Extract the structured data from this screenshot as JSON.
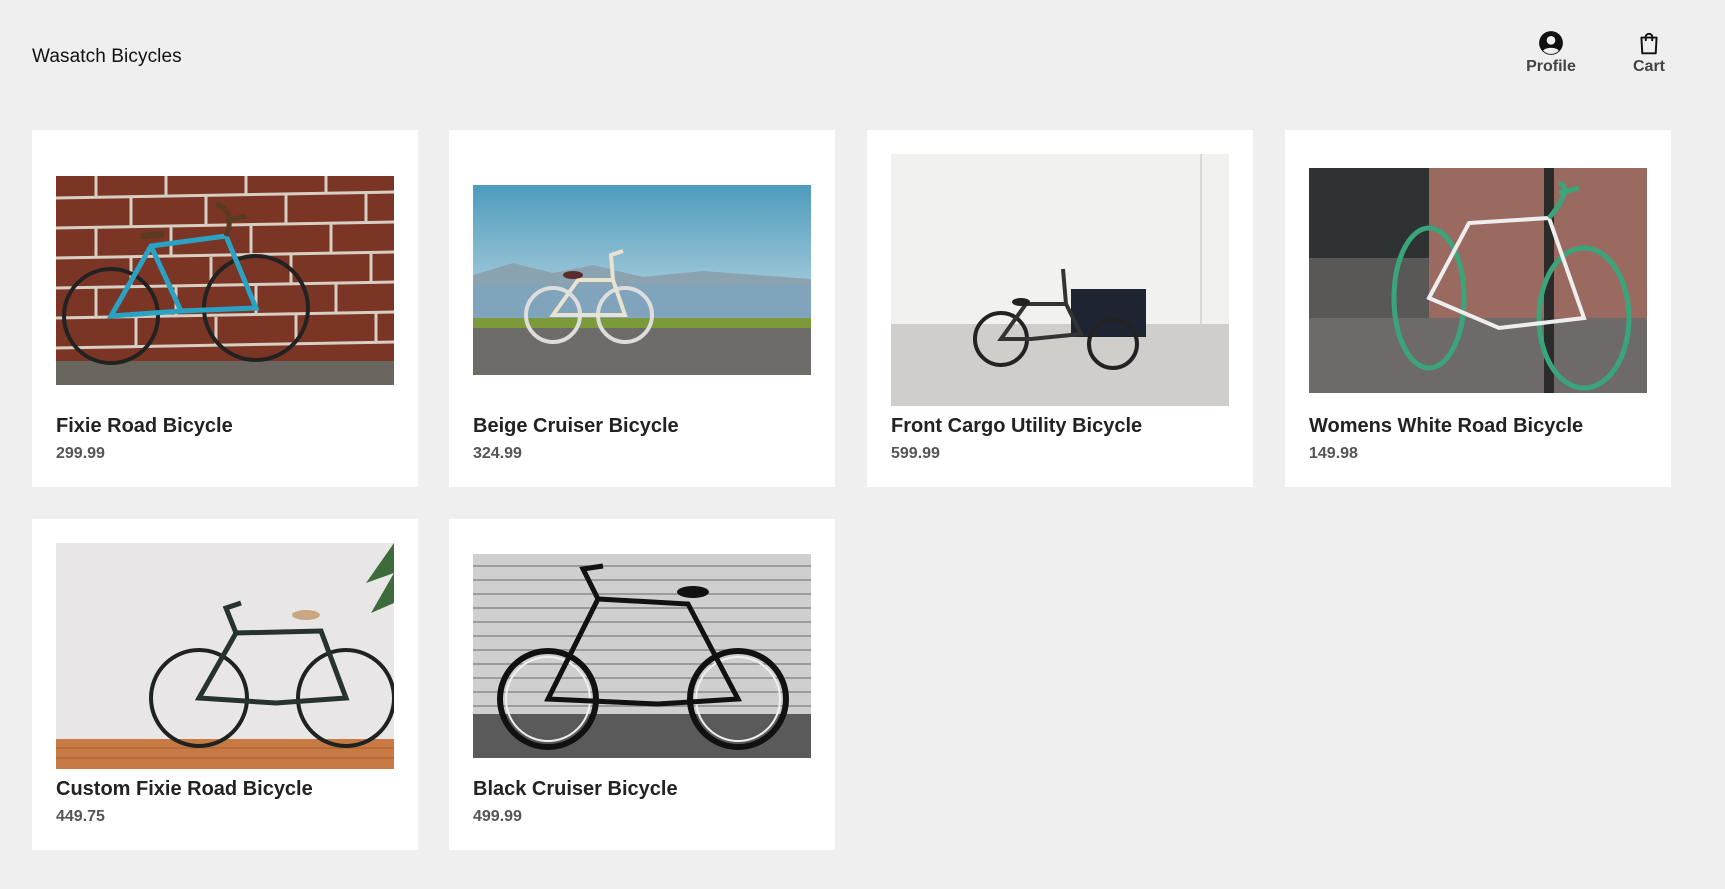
{
  "header": {
    "brand": "Wasatch Bicycles",
    "profile_label": "Profile",
    "cart_label": "Cart",
    "profile_icon": "user-circle-icon",
    "cart_icon": "shopping-bag-icon"
  },
  "products": [
    {
      "name": "Fixie Road Bicycle",
      "price": "299.99"
    },
    {
      "name": "Beige Cruiser Bicycle",
      "price": "324.99"
    },
    {
      "name": "Front Cargo Utility Bicycle",
      "price": "599.99"
    },
    {
      "name": "Womens White Road Bicycle",
      "price": "149.98"
    },
    {
      "name": "Custom Fixie Road Bicycle",
      "price": "449.75"
    },
    {
      "name": "Black Cruiser Bicycle",
      "price": "499.99"
    }
  ],
  "colors": {
    "background": "#efefef",
    "card": "#ffffff",
    "text": "#222222",
    "price": "#555555"
  }
}
